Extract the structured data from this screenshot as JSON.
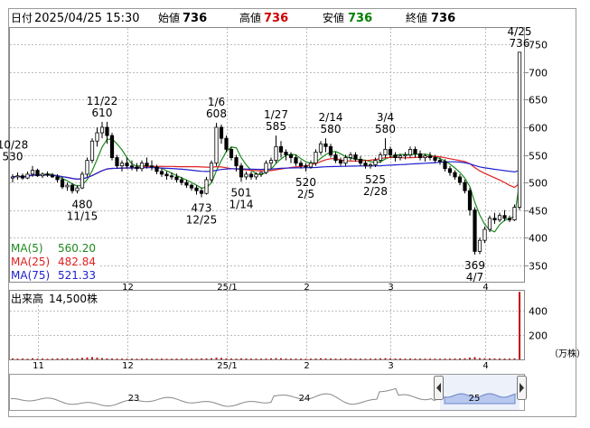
{
  "header": {
    "date_label": "日付",
    "datetime": "2025/04/25 15:30",
    "open_label": "始値",
    "open_value": "736",
    "high_label": "高値",
    "high_value": "736",
    "low_label": "安値",
    "low_value": "736",
    "close_label": "終値",
    "close_value": "736"
  },
  "colors": {
    "up": "#000000",
    "down": "#000000",
    "ma5": "#1b8a1b",
    "ma25": "#e02020",
    "ma75": "#2020d0",
    "volume": "#c00000",
    "high_text": "#d00000",
    "low_text": "#008000",
    "grid": "#bcbcbc",
    "navigator_fill": "#b8c8ee"
  },
  "chart_data": {
    "type": "candlestick",
    "price_axis": {
      "ticks": [
        350,
        400,
        450,
        500,
        550,
        600,
        650,
        700,
        750
      ],
      "range": [
        320,
        780
      ]
    },
    "x_ticks": [
      {
        "label": "12",
        "index": 23
      },
      {
        "label": "25/1",
        "index": 43
      },
      {
        "label": "2",
        "index": 59
      },
      {
        "label": "3",
        "index": 76
      },
      {
        "label": "4",
        "index": 95
      }
    ],
    "volume_x_ticks": [
      {
        "label": "11",
        "index": 5
      },
      {
        "label": "12",
        "index": 23
      },
      {
        "label": "25/1",
        "index": 43
      },
      {
        "label": "2",
        "index": 59
      },
      {
        "label": "3",
        "index": 76
      },
      {
        "label": "4",
        "index": 95
      }
    ],
    "candles": [
      [
        508,
        515,
        500,
        510
      ],
      [
        510,
        518,
        505,
        512
      ],
      [
        512,
        516,
        505,
        508
      ],
      [
        508,
        520,
        506,
        515
      ],
      [
        515,
        530,
        510,
        522
      ],
      [
        522,
        525,
        510,
        512
      ],
      [
        512,
        518,
        508,
        515
      ],
      [
        515,
        520,
        510,
        513
      ],
      [
        513,
        517,
        508,
        510
      ],
      [
        510,
        515,
        500,
        505
      ],
      [
        505,
        510,
        488,
        492
      ],
      [
        492,
        500,
        485,
        495
      ],
      [
        495,
        498,
        480,
        485
      ],
      [
        485,
        495,
        480,
        490
      ],
      [
        490,
        520,
        488,
        515
      ],
      [
        515,
        545,
        510,
        540
      ],
      [
        540,
        580,
        535,
        575
      ],
      [
        575,
        600,
        565,
        590
      ],
      [
        590,
        610,
        580,
        600
      ],
      [
        600,
        610,
        570,
        585
      ],
      [
        585,
        590,
        540,
        545
      ],
      [
        545,
        550,
        525,
        530
      ],
      [
        530,
        540,
        520,
        535
      ],
      [
        535,
        545,
        525,
        530
      ],
      [
        530,
        540,
        522,
        528
      ],
      [
        528,
        535,
        520,
        525
      ],
      [
        525,
        540,
        520,
        535
      ],
      [
        535,
        545,
        525,
        530
      ],
      [
        530,
        540,
        522,
        528
      ],
      [
        528,
        532,
        515,
        520
      ],
      [
        520,
        525,
        510,
        515
      ],
      [
        515,
        520,
        505,
        512
      ],
      [
        512,
        518,
        505,
        510
      ],
      [
        510,
        516,
        500,
        505
      ],
      [
        505,
        510,
        495,
        500
      ],
      [
        500,
        505,
        490,
        495
      ],
      [
        495,
        498,
        485,
        490
      ],
      [
        490,
        495,
        478,
        485
      ],
      [
        485,
        490,
        473,
        480
      ],
      [
        480,
        510,
        478,
        505
      ],
      [
        505,
        540,
        500,
        535
      ],
      [
        535,
        608,
        530,
        600
      ],
      [
        600,
        605,
        570,
        580
      ],
      [
        580,
        585,
        555,
        560
      ],
      [
        560,
        565,
        540,
        545
      ],
      [
        545,
        550,
        520,
        530
      ],
      [
        530,
        535,
        501,
        510
      ],
      [
        510,
        520,
        505,
        515
      ],
      [
        515,
        520,
        505,
        510
      ],
      [
        510,
        518,
        505,
        515
      ],
      [
        515,
        520,
        510,
        518
      ],
      [
        518,
        540,
        515,
        535
      ],
      [
        535,
        545,
        525,
        540
      ],
      [
        540,
        585,
        535,
        565
      ],
      [
        565,
        575,
        545,
        555
      ],
      [
        555,
        560,
        540,
        550
      ],
      [
        550,
        555,
        535,
        545
      ],
      [
        545,
        550,
        530,
        535
      ],
      [
        535,
        540,
        525,
        530
      ],
      [
        530,
        535,
        520,
        528
      ],
      [
        528,
        540,
        525,
        535
      ],
      [
        535,
        560,
        530,
        555
      ],
      [
        555,
        575,
        550,
        570
      ],
      [
        570,
        580,
        555,
        565
      ],
      [
        565,
        570,
        545,
        550
      ],
      [
        550,
        555,
        535,
        540
      ],
      [
        540,
        545,
        530,
        535
      ],
      [
        535,
        550,
        530,
        545
      ],
      [
        545,
        555,
        540,
        550
      ],
      [
        550,
        555,
        538,
        542
      ],
      [
        542,
        548,
        530,
        535
      ],
      [
        535,
        540,
        525,
        530
      ],
      [
        530,
        535,
        525,
        532
      ],
      [
        532,
        545,
        528,
        540
      ],
      [
        540,
        555,
        535,
        550
      ],
      [
        550,
        580,
        545,
        560
      ],
      [
        560,
        565,
        545,
        550
      ],
      [
        550,
        555,
        538,
        545
      ],
      [
        545,
        552,
        540,
        548
      ],
      [
        548,
        555,
        542,
        550
      ],
      [
        550,
        565,
        545,
        560
      ],
      [
        560,
        565,
        545,
        552
      ],
      [
        552,
        558,
        540,
        545
      ],
      [
        545,
        552,
        538,
        548
      ],
      [
        548,
        555,
        540,
        545
      ],
      [
        545,
        550,
        535,
        540
      ],
      [
        540,
        545,
        532,
        538
      ],
      [
        538,
        542,
        520,
        525
      ],
      [
        525,
        530,
        512,
        518
      ],
      [
        518,
        522,
        505,
        510
      ],
      [
        510,
        515,
        495,
        500
      ],
      [
        500,
        505,
        480,
        485
      ],
      [
        485,
        490,
        440,
        450
      ],
      [
        450,
        455,
        369,
        375
      ],
      [
        375,
        400,
        370,
        395
      ],
      [
        395,
        420,
        390,
        415
      ],
      [
        415,
        440,
        410,
        435
      ],
      [
        435,
        445,
        425,
        432
      ],
      [
        432,
        445,
        428,
        440
      ],
      [
        440,
        450,
        430,
        435
      ],
      [
        435,
        440,
        428,
        432
      ],
      [
        432,
        460,
        430,
        455
      ],
      [
        455,
        736,
        450,
        736
      ]
    ],
    "ma": [
      {
        "name": "MA(5)",
        "value_label": "560.20",
        "period": 5
      },
      {
        "name": "MA(25)",
        "value_label": "482.84",
        "period": 25
      },
      {
        "name": "MA(75)",
        "value_label": "521.33",
        "period": 75
      }
    ],
    "annotations": [
      {
        "index": 0,
        "lines": [
          "10/28",
          "530"
        ],
        "pos": "above",
        "price": 530
      },
      {
        "index": 14,
        "lines": [
          "480",
          "11/15"
        ],
        "pos": "below",
        "price": 480
      },
      {
        "index": 18,
        "lines": [
          "11/22",
          "610"
        ],
        "pos": "above",
        "price": 610
      },
      {
        "index": 38,
        "lines": [
          "473",
          "12/25"
        ],
        "pos": "below",
        "price": 473
      },
      {
        "index": 41,
        "lines": [
          "1/6",
          "608"
        ],
        "pos": "above",
        "price": 608
      },
      {
        "index": 46,
        "lines": [
          "501",
          "1/14"
        ],
        "pos": "below",
        "price": 501
      },
      {
        "index": 53,
        "lines": [
          "1/27",
          "585"
        ],
        "pos": "above",
        "price": 585
      },
      {
        "index": 59,
        "lines": [
          "520",
          "2/5"
        ],
        "pos": "below",
        "price": 520
      },
      {
        "index": 64,
        "lines": [
          "2/14",
          "580"
        ],
        "pos": "above",
        "price": 580
      },
      {
        "index": 73,
        "lines": [
          "525",
          "2/28"
        ],
        "pos": "below",
        "price": 525
      },
      {
        "index": 75,
        "lines": [
          "3/4",
          "580"
        ],
        "pos": "above",
        "price": 580
      },
      {
        "index": 93,
        "lines": [
          "369",
          "4/7"
        ],
        "pos": "below",
        "price": 369
      },
      {
        "index": 102,
        "lines": [
          "4/25",
          "736"
        ],
        "pos": "above",
        "price": 736
      }
    ],
    "volume": {
      "label": "出来高",
      "value_label": "14,500株",
      "unit_label": "（万株）",
      "axis_ticks": [
        200,
        400
      ],
      "range": [
        0,
        560
      ],
      "values": [
        8,
        6,
        7,
        5,
        9,
        6,
        7,
        5,
        6,
        8,
        7,
        9,
        6,
        8,
        12,
        15,
        18,
        14,
        10,
        8,
        7,
        6,
        6,
        5,
        6,
        5,
        6,
        7,
        6,
        5,
        6,
        5,
        5,
        6,
        5,
        6,
        5,
        6,
        7,
        8,
        9,
        14,
        12,
        8,
        7,
        6,
        8,
        7,
        6,
        6,
        6,
        7,
        8,
        10,
        9,
        7,
        6,
        6,
        6,
        5,
        6,
        7,
        9,
        8,
        7,
        6,
        6,
        7,
        7,
        6,
        6,
        5,
        6,
        7,
        8,
        10,
        8,
        7,
        7,
        6,
        7,
        6,
        6,
        6,
        6,
        6,
        5,
        6,
        6,
        7,
        8,
        9,
        14,
        18,
        10,
        9,
        8,
        7,
        7,
        7,
        6,
        8,
        550
      ]
    },
    "navigator": {
      "labels": [
        {
          "text": "23",
          "x": 148
        },
        {
          "text": "24",
          "x": 337
        },
        {
          "text": "25",
          "x": 525
        }
      ]
    }
  }
}
